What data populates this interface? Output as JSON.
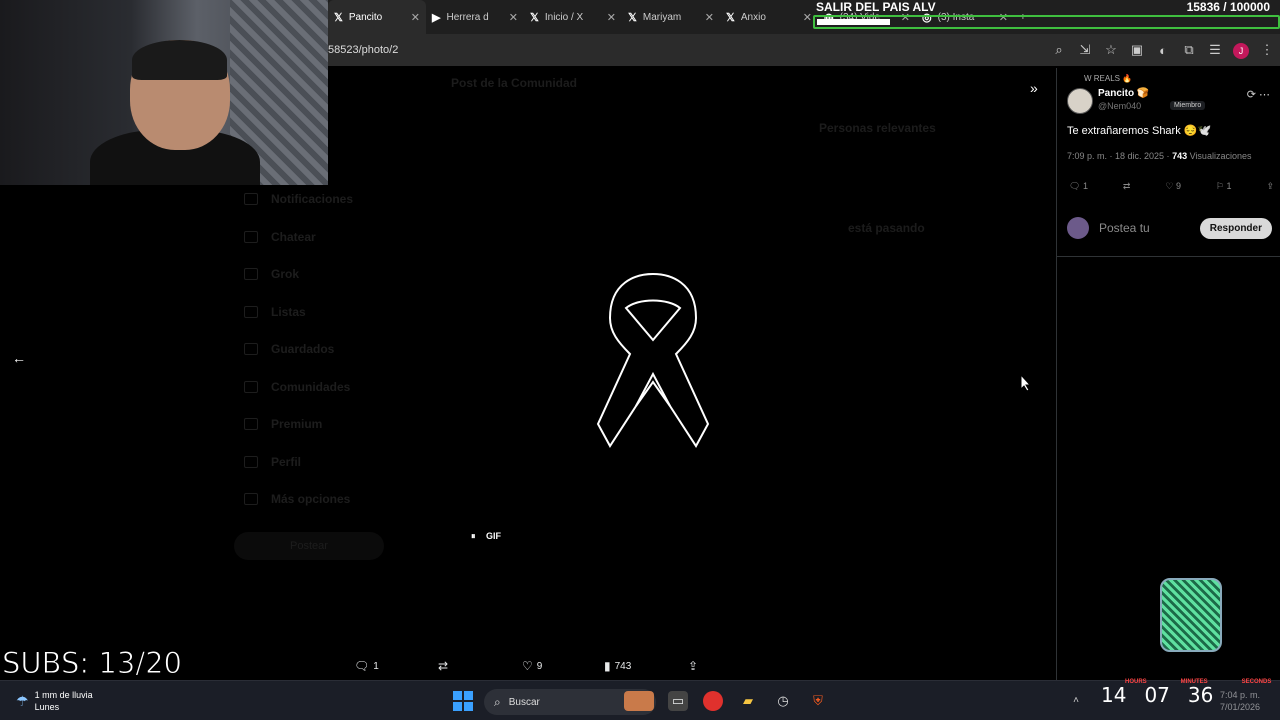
{
  "browser": {
    "tabs": [
      {
        "icon": "x-logo-icon",
        "glyph": "𝕏",
        "label": "Pancito",
        "active": true
      },
      {
        "icon": "youtube-icon",
        "glyph": "▶",
        "label": "Herrera d",
        "active": false
      },
      {
        "icon": "x-logo-icon",
        "glyph": "𝕏",
        "label": "Inicio / X",
        "active": false
      },
      {
        "icon": "x-logo-icon",
        "glyph": "𝕏",
        "label": "Mariyam",
        "active": false
      },
      {
        "icon": "x-logo-icon",
        "glyph": "𝕏",
        "label": "Anxio",
        "active": false
      },
      {
        "icon": "tab-icon",
        "glyph": "◍",
        "label": "(34) Vide",
        "active": false
      },
      {
        "icon": "instagram-icon",
        "glyph": "◎",
        "label": "(3) Insta",
        "active": false
      }
    ],
    "tab_close": "✕",
    "new_tab": "+",
    "url": "58523/photo/2",
    "profile_initial": "J"
  },
  "goal": {
    "title": "SALIR DEL PAIS ALV",
    "count": "15836 / 100000",
    "progress": 0.158
  },
  "backdrop": {
    "post_title": "Post de la Comunidad",
    "relevant": "Personas relevantes",
    "happening": "está pasando",
    "nav": [
      "Notificaciones",
      "Chatear",
      "Grok",
      "Listas",
      "Guardados",
      "Comunidades",
      "Premium",
      "Perfil",
      "Más opciones"
    ],
    "post_button": "Postear"
  },
  "media": {
    "gif_label": "GIF",
    "pause_glyph": "⏸"
  },
  "actions": {
    "replies": "1",
    "reposts": "",
    "likes": "9",
    "views": "743"
  },
  "right_panel": {
    "context": "W REALS 🔥",
    "name": "Pancito 🍞",
    "handle": "@Nem040",
    "badge": "Miembro",
    "text": "Te extrañaremos Shark 😔🕊️",
    "time": "7:09 p. m. · 18 dic. 2025 · ",
    "views": "743",
    "views_label": " Visualizaciones",
    "stats": {
      "replies": "1",
      "reposts": "",
      "likes": "9",
      "bookmarks": "1"
    },
    "compose_placeholder": "Postea tu",
    "reply_button": "Responder"
  },
  "overlay": {
    "subs": "SUBS: 13/20",
    "timer": {
      "hours": "14",
      "minutes": "07",
      "seconds": "36"
    },
    "timer_labels": {
      "hours": "HOURS",
      "minutes": "MINUTES",
      "seconds": "SECONDS"
    }
  },
  "taskbar": {
    "weather_line1": "1 mm de lluvia",
    "weather_line2": "Lunes",
    "search_label": "Buscar",
    "clock_time": "7:04 p. m.",
    "clock_date": "7/01/2026"
  },
  "colors": {
    "accent_green": "#3fbf3f",
    "win_blue": "#3aa0ff",
    "timer_red": "#ff4545"
  }
}
